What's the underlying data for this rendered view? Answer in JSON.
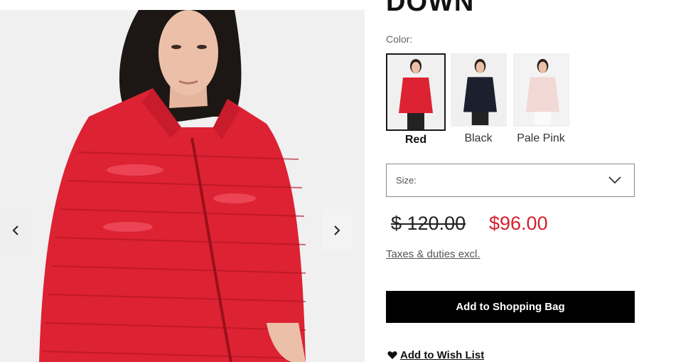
{
  "product": {
    "title": "DOWN",
    "color_label": "Color:",
    "colors": [
      {
        "name": "Red",
        "swatch": "#dc2233",
        "selected": true
      },
      {
        "name": "Black",
        "swatch": "#1b1f2e",
        "selected": false
      },
      {
        "name": "Pale Pink",
        "swatch": "#f2d9d6",
        "selected": false
      }
    ],
    "size_label": "Size:",
    "price_original": "$ 120.00",
    "price_sale": "$96.00",
    "taxes_link": "Taxes & duties excl.",
    "add_to_bag": "Add to Shopping Bag",
    "wish_list": "Add to Wish List"
  },
  "icons": {
    "prev": "chevron-left-icon",
    "next": "chevron-right-icon",
    "dropdown": "chevron-down-icon",
    "wish": "heart-icon"
  },
  "colors": {
    "sale_price": "#d4202c",
    "button_bg": "#000000",
    "jacket_red": "#dc2233"
  }
}
